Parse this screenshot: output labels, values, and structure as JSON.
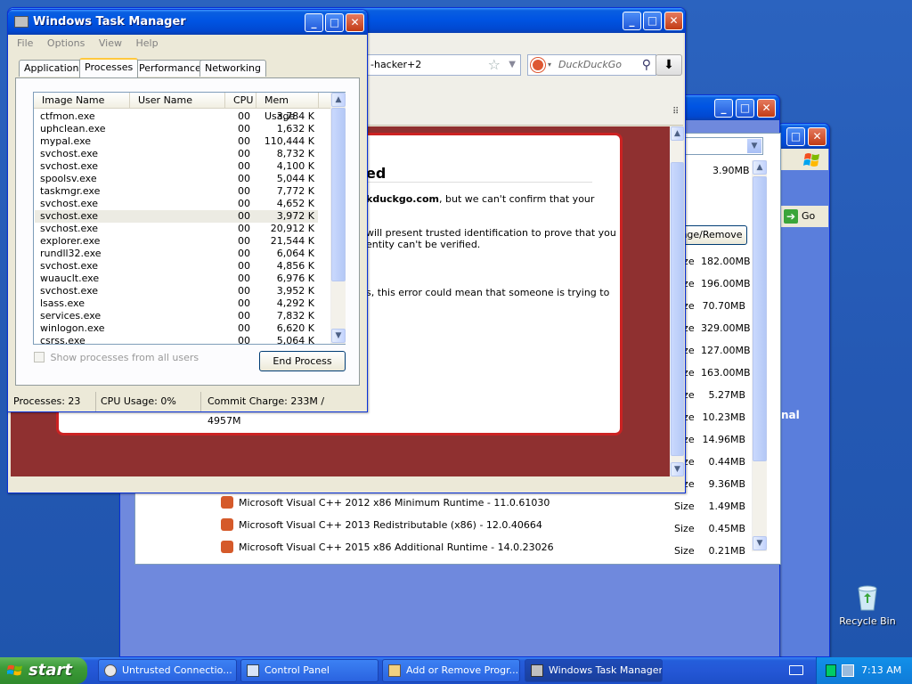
{
  "taskbar": {
    "start_label": "start",
    "items": [
      {
        "label": "Untrusted Connectio..."
      },
      {
        "label": "Control Panel"
      },
      {
        "label": "Add or Remove Progr..."
      },
      {
        "label": "Windows Task Manager"
      }
    ],
    "clock": "7:13 AM"
  },
  "desktop": {
    "recycle_bin_label": "Recycle Bin"
  },
  "browser": {
    "url_fragment": "-hacker+2",
    "search_engine": "DuckDuckGo",
    "error": {
      "title_fragment": "ed",
      "line1_bold": "kduckgo.com",
      "line1_rest": ", but we can't confirm that your",
      "line2": "will present trusted identification to prove that you",
      "line3": "entity can't be verified.",
      "line4": "s, this error could mean that someone is trying to"
    }
  },
  "control_panel": {
    "go_label": "Go",
    "partial_text": "nal"
  },
  "add_remove": {
    "change_remove_label": "nge/Remove",
    "top_size": "3.90MB",
    "sizes": [
      {
        "label": "Size",
        "value": "182.00MB"
      },
      {
        "label": "Size",
        "value": "196.00MB"
      },
      {
        "label": "Size",
        "value": "70.70MB"
      },
      {
        "label": "Size",
        "value": "329.00MB"
      },
      {
        "label": "Size",
        "value": "127.00MB"
      },
      {
        "label": "Size",
        "value": "163.00MB"
      },
      {
        "label": "Size",
        "value": "5.27MB"
      },
      {
        "label": "Size",
        "value": "10.23MB"
      },
      {
        "label": "Size",
        "value": "14.96MB"
      },
      {
        "label": "Size",
        "value": "0.44MB"
      },
      {
        "label": "Size",
        "value": "9.36MB"
      },
      {
        "label": "Size",
        "value": "1.49MB"
      },
      {
        "label": "Size",
        "value": "0.45MB"
      },
      {
        "label": "Size",
        "value": "0.21MB"
      }
    ],
    "programs": [
      "Microsoft Visual C++ 2012 x86 Minimum Runtime - 11.0.61030",
      "Microsoft Visual C++ 2013 Redistributable (x86) - 12.0.40664",
      "Microsoft Visual C++ 2015 x86 Additional Runtime - 14.0.23026"
    ]
  },
  "taskmgr": {
    "title": "Windows Task Manager",
    "menu": [
      "File",
      "Options",
      "View",
      "Help"
    ],
    "tabs": [
      "Applications",
      "Processes",
      "Performance",
      "Networking"
    ],
    "columns": [
      "Image Name",
      "User Name",
      "CPU",
      "Mem Usage"
    ],
    "processes": [
      {
        "name": "ctfmon.exe",
        "user": "",
        "cpu": "00",
        "mem": "3,784 K"
      },
      {
        "name": "uphclean.exe",
        "user": "",
        "cpu": "00",
        "mem": "1,632 K"
      },
      {
        "name": "mypal.exe",
        "user": "",
        "cpu": "00",
        "mem": "110,444 K"
      },
      {
        "name": "svchost.exe",
        "user": "",
        "cpu": "00",
        "mem": "8,732 K"
      },
      {
        "name": "svchost.exe",
        "user": "",
        "cpu": "00",
        "mem": "4,100 K"
      },
      {
        "name": "spoolsv.exe",
        "user": "",
        "cpu": "00",
        "mem": "5,044 K"
      },
      {
        "name": "taskmgr.exe",
        "user": "",
        "cpu": "00",
        "mem": "7,772 K"
      },
      {
        "name": "svchost.exe",
        "user": "",
        "cpu": "00",
        "mem": "4,652 K"
      },
      {
        "name": "svchost.exe",
        "user": "",
        "cpu": "00",
        "mem": "3,972 K"
      },
      {
        "name": "svchost.exe",
        "user": "",
        "cpu": "00",
        "mem": "20,912 K"
      },
      {
        "name": "explorer.exe",
        "user": "",
        "cpu": "00",
        "mem": "21,544 K"
      },
      {
        "name": "rundll32.exe",
        "user": "",
        "cpu": "00",
        "mem": "6,064 K"
      },
      {
        "name": "svchost.exe",
        "user": "",
        "cpu": "00",
        "mem": "4,856 K"
      },
      {
        "name": "wuauclt.exe",
        "user": "",
        "cpu": "00",
        "mem": "6,976 K"
      },
      {
        "name": "svchost.exe",
        "user": "",
        "cpu": "00",
        "mem": "3,952 K"
      },
      {
        "name": "lsass.exe",
        "user": "",
        "cpu": "00",
        "mem": "4,292 K"
      },
      {
        "name": "services.exe",
        "user": "",
        "cpu": "00",
        "mem": "7,832 K"
      },
      {
        "name": "winlogon.exe",
        "user": "",
        "cpu": "00",
        "mem": "6,620 K"
      },
      {
        "name": "csrss.exe",
        "user": "",
        "cpu": "00",
        "mem": "5,064 K"
      }
    ],
    "show_all_label": "Show processes from all users",
    "end_process_label": "End Process",
    "status": {
      "processes": "Processes: 23",
      "cpu": "CPU Usage: 0%",
      "commit": "Commit Charge: 233M / 4957M"
    }
  }
}
